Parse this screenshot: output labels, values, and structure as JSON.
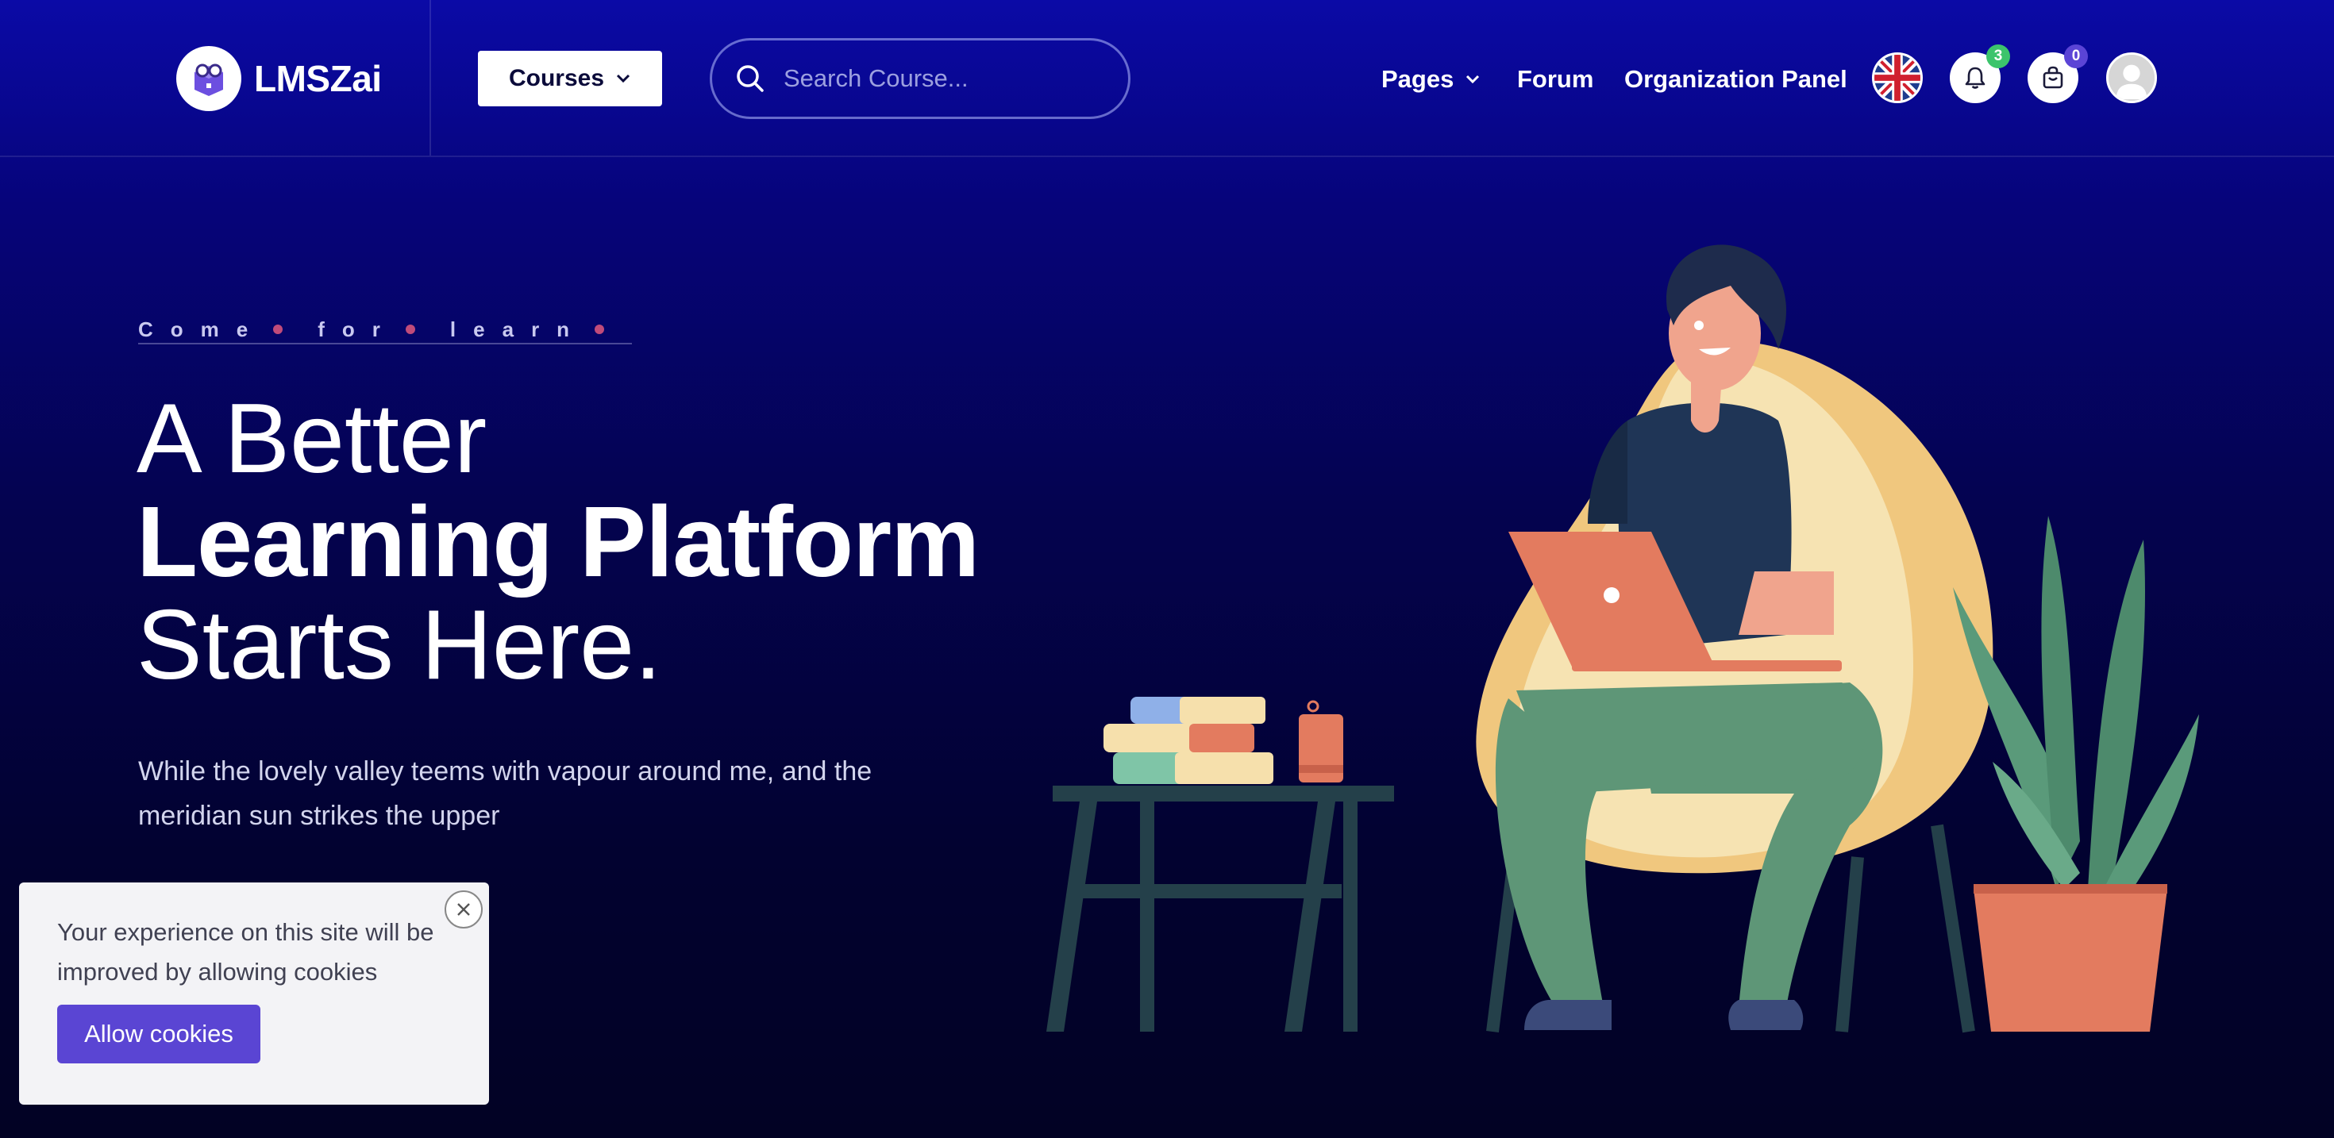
{
  "header": {
    "brand": "LMSZai",
    "courses_label": "Courses",
    "search_placeholder": "Search Course...",
    "nav": {
      "pages": "Pages",
      "forum": "Forum",
      "organization_panel": "Organization Panel"
    },
    "notification_count": "3",
    "cart_count": "0"
  },
  "hero": {
    "tagline_words": [
      "Come",
      "for",
      "learn"
    ],
    "title_line1": "A Better",
    "title_line2": "Learning Platform",
    "title_line3": "Starts Here.",
    "subtitle": "While the lovely valley teems with vapour around me, and the meridian sun strikes the upper"
  },
  "cookie": {
    "message": "Your experience on this site will be improved by allowing cookies",
    "button_label": "Allow cookies"
  },
  "colors": {
    "accent": "#5a45d3",
    "badge_green": "#3cc46c",
    "tagline_dot": "#c04b7a"
  },
  "icons": [
    "logo-icon",
    "chevron-down-icon",
    "search-icon",
    "uk-flag-icon",
    "bell-icon",
    "cart-icon",
    "user-avatar-icon",
    "close-icon"
  ]
}
